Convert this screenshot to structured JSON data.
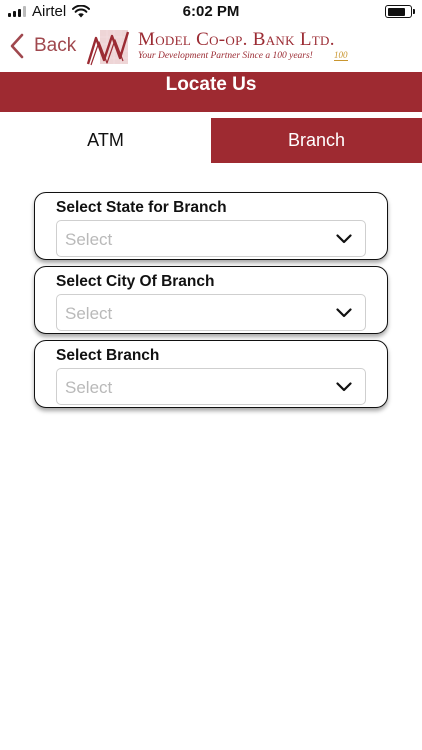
{
  "status_bar": {
    "carrier": "Airtel",
    "time": "6:02 PM",
    "signal_icon": "signal-bars-icon",
    "wifi_icon": "wifi-icon",
    "battery_icon": "battery-icon",
    "battery_level": 0.78
  },
  "nav": {
    "back_label": "Back",
    "back_icon": "chevron-left-icon",
    "logo": {
      "title_initial_1": "M",
      "title_rest_1": "odel ",
      "title_initial_2": "C",
      "title_rest_2": "o-op. ",
      "title_initial_3": "B",
      "title_rest_3": "ank ",
      "title_initial_4": "L",
      "title_rest_4": "td.",
      "tagline": "Your Development Partner Since a 100 years!",
      "badge": "100"
    }
  },
  "header": {
    "title": "Locate Us"
  },
  "tabs": [
    {
      "label": "ATM",
      "selected": false
    },
    {
      "label": "Branch",
      "selected": true
    }
  ],
  "form": {
    "fields": [
      {
        "label": "Select State for Branch",
        "value": "Select"
      },
      {
        "label": "Select City Of Branch",
        "value": "Select"
      },
      {
        "label": "Select Branch",
        "value": "Select"
      }
    ]
  },
  "colors": {
    "brand": "#9e2a31",
    "back_link": "#a0484e",
    "placeholder": "#b9b9b9",
    "badge_gold": "#c9962f"
  }
}
